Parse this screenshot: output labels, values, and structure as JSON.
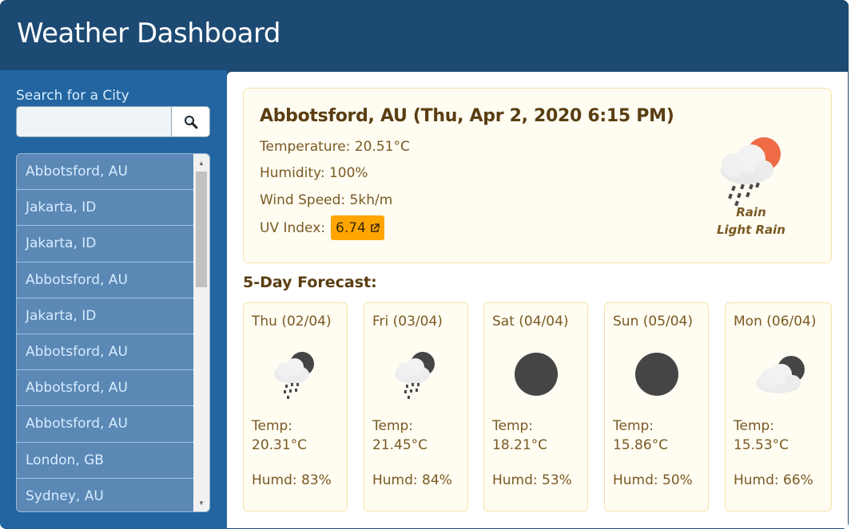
{
  "app": {
    "title": "Weather Dashboard"
  },
  "sidebar": {
    "search_label": "Search for a City",
    "search_value": "",
    "search_icon": "magnifier-icon",
    "cities": [
      "Abbotsford, AU",
      "Jakarta, ID",
      "Jakarta, ID",
      "Abbotsford, AU",
      "Jakarta, ID",
      "Abbotsford, AU",
      "Abbotsford, AU",
      "Abbotsford, AU",
      "London, GB",
      "Sydney, AU"
    ]
  },
  "current": {
    "title": "Abbotsford, AU (Thu, Apr 2, 2020 6:15 PM)",
    "temperature": "Temperature: 20.51°C",
    "humidity": "Humidity: 100%",
    "wind": "Wind Speed: 5kh/m",
    "uv_label": "UV Index:",
    "uv_value": "6.74",
    "uv_icon": "external-link-icon",
    "condition": "Rain",
    "description": "Light Rain",
    "icon": "sun-cloud-rain-icon"
  },
  "forecast": {
    "title": "5-Day Forecast:",
    "temp_label": "Temp:",
    "days": [
      {
        "day": "Thu (02/04)",
        "temp": "20.31°C",
        "humidity": "Humd: 83%",
        "icon": "moon-cloud-rain-icon"
      },
      {
        "day": "Fri (03/04)",
        "temp": "21.45°C",
        "humidity": "Humd: 84%",
        "icon": "moon-cloud-rain-icon"
      },
      {
        "day": "Sat (04/04)",
        "temp": "18.21°C",
        "humidity": "Humd: 53%",
        "icon": "moon-icon"
      },
      {
        "day": "Sun (05/04)",
        "temp": "15.86°C",
        "humidity": "Humd: 50%",
        "icon": "moon-icon"
      },
      {
        "day": "Mon (06/04)",
        "temp": "15.53°C",
        "humidity": "Humd: 66%",
        "icon": "moon-cloud-icon"
      }
    ]
  },
  "colors": {
    "header": "#1d4a73",
    "sidebar": "#2265a0",
    "list_item": "#5b88b5",
    "card_bg": "#fffcf2",
    "card_border": "#f5e2a8",
    "uv_badge": "#ffa500",
    "text_brown": "#7a5a22"
  }
}
